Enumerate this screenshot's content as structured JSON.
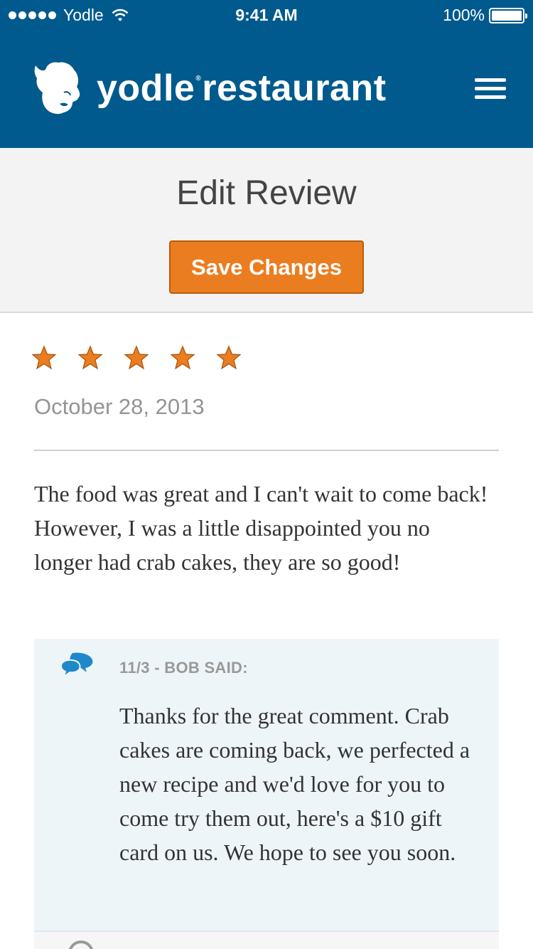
{
  "status_bar": {
    "carrier": "Yodle",
    "time": "9:41 AM",
    "battery": "100%"
  },
  "header": {
    "brand_part1": "yodle",
    "brand_part2": "restaurant",
    "registered_mark": "®",
    "logo_icon": "yodle-head-logo",
    "menu_icon": "hamburger-menu-icon",
    "background_color": "#005a8e"
  },
  "page": {
    "title": "Edit Review",
    "save_button_label": "Save Changes",
    "accent_color": "#ea7d1f"
  },
  "review": {
    "rating": 5,
    "rating_max": 5,
    "date": "October 28, 2013",
    "text": "The food was great and I can't wait to come back! However, I was a little disappointed you no longer had crab cakes, they are so good!"
  },
  "reply": {
    "icon": "speech-bubbles-icon",
    "heading": "11/3 - BOB SAID:",
    "text": "Thanks for the great comment. Crab cakes are coming back, we perfected a new recipe and we'd love for you to come try them out, here's a $10 gift card on us. We hope to see you soon."
  }
}
